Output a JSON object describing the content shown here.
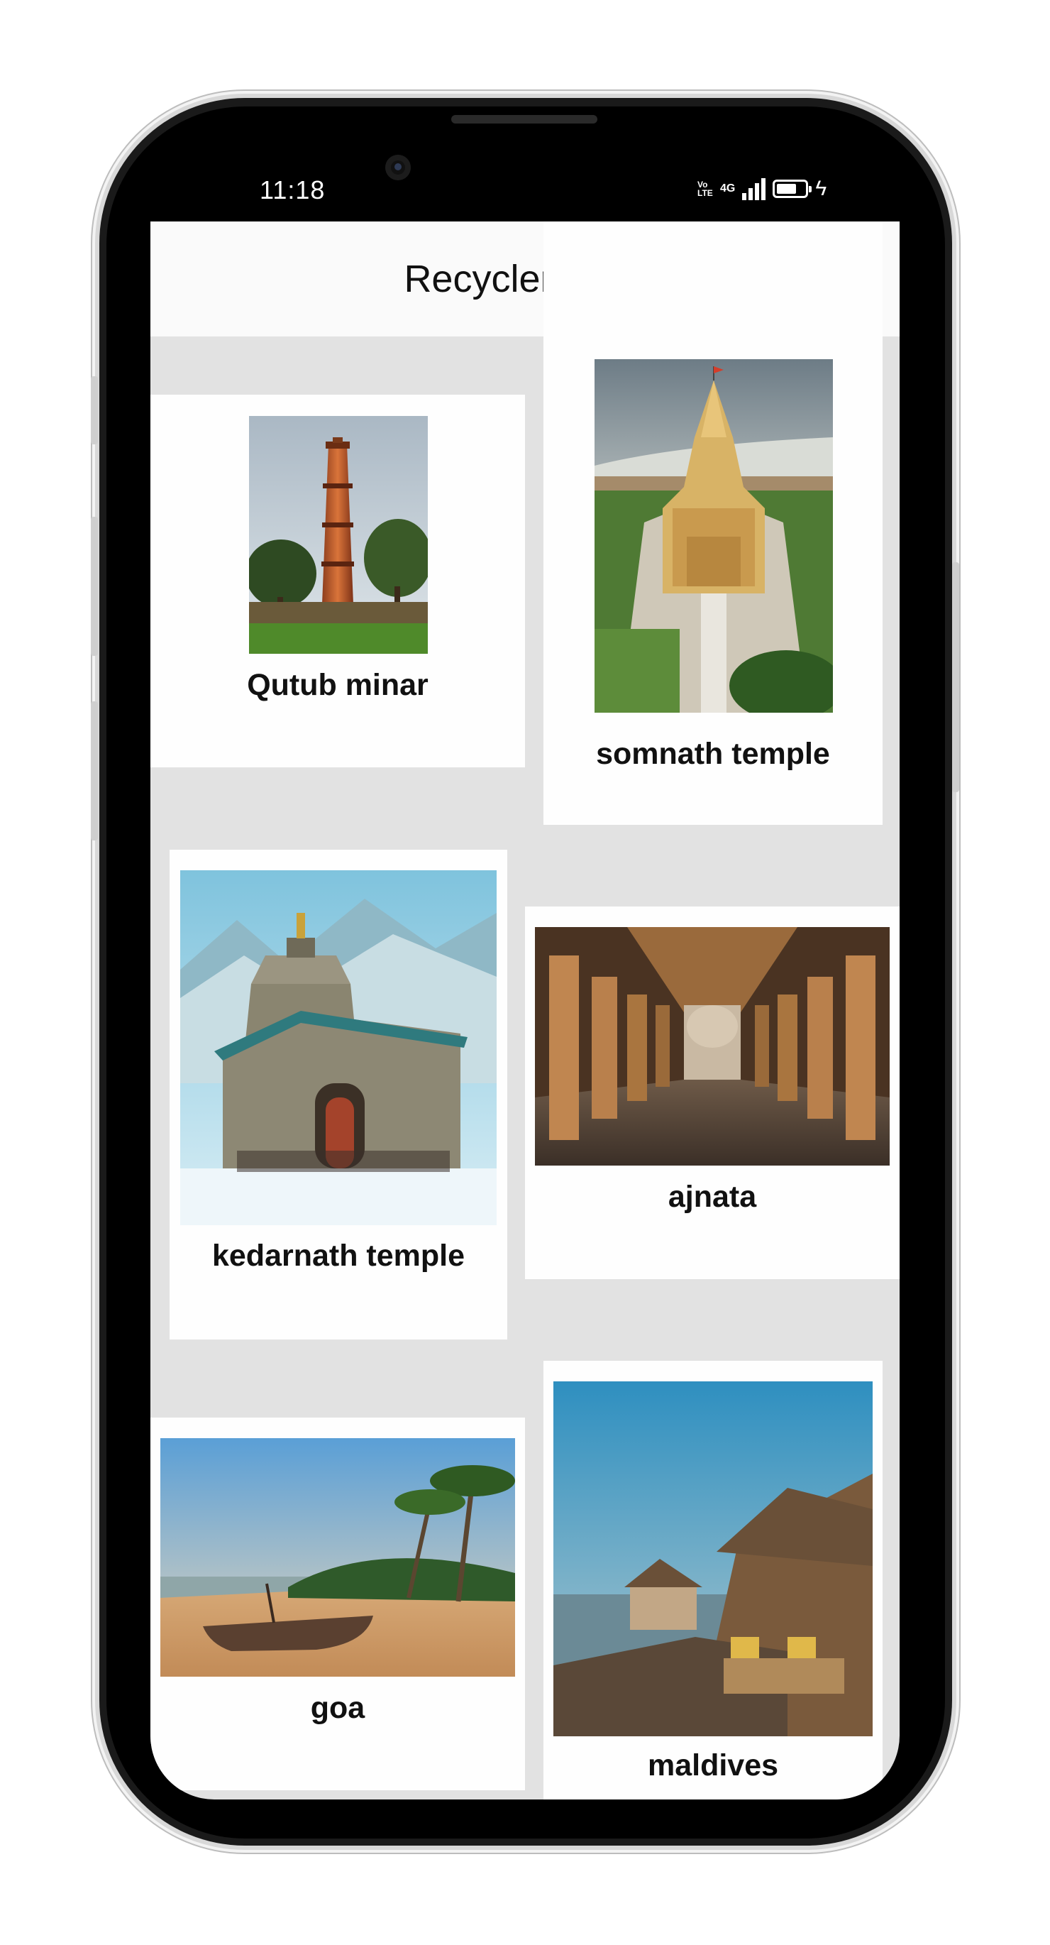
{
  "status_bar": {
    "time": "11:18",
    "volte": "Vo LTE",
    "network": "4G",
    "battery_level": 0.7
  },
  "app_bar": {
    "title": "Recycler View"
  },
  "items": [
    {
      "label": "Qutub minar"
    },
    {
      "label": "somnath temple"
    },
    {
      "label": "kedarnath temple"
    },
    {
      "label": "ajnata"
    },
    {
      "label": "goa"
    },
    {
      "label": "maldives"
    }
  ],
  "colors": {
    "background_grid": "#e2e2e2",
    "card": "#fefefe",
    "text": "#111111"
  }
}
